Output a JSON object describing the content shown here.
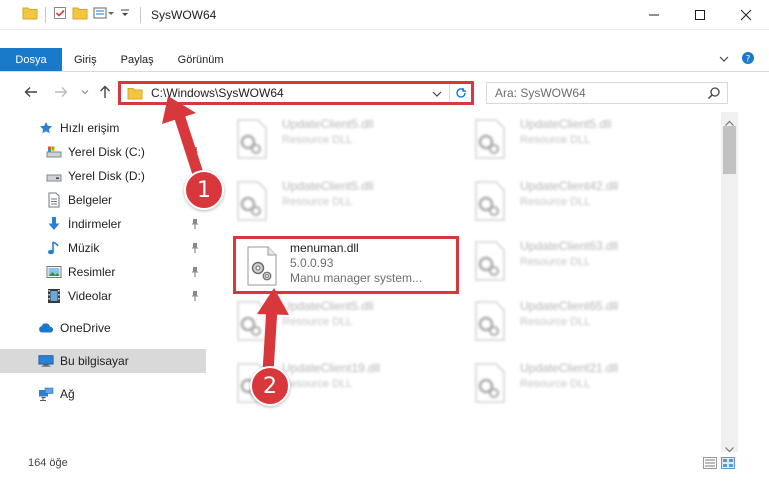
{
  "window": {
    "title": "SysWOW64"
  },
  "ribbon": {
    "tabs": [
      "Dosya",
      "Giriş",
      "Paylaş",
      "Görünüm"
    ]
  },
  "address": {
    "path": "C:\\Windows\\SysWOW64",
    "search_placeholder": "Ara: SysWOW64"
  },
  "sidebar": {
    "items": [
      {
        "label": "Hızlı erişim",
        "icon": "star-icon"
      },
      {
        "label": "Yerel Disk (C:)",
        "icon": "drive-icon"
      },
      {
        "label": "Yerel Disk (D:)",
        "icon": "drive-icon"
      },
      {
        "label": "Belgeler",
        "icon": "document-icon"
      },
      {
        "label": "İndirmeler",
        "icon": "download-icon"
      },
      {
        "label": "Müzik",
        "icon": "music-icon"
      },
      {
        "label": "Resimler",
        "icon": "pictures-icon"
      },
      {
        "label": "Videolar",
        "icon": "video-icon"
      },
      {
        "label": "OneDrive",
        "icon": "cloud-icon"
      },
      {
        "label": "Bu bilgisayar",
        "icon": "computer-icon"
      },
      {
        "label": "Ağ",
        "icon": "network-icon"
      }
    ]
  },
  "files": [
    {
      "name": "UpdateClient5.dll",
      "type": "Resource DLL"
    },
    {
      "name": "UpdateClient5.dll",
      "type": "Resource DLL"
    },
    {
      "name": "UpdateClient5.dll",
      "type": "Resource DLL"
    },
    {
      "name": "UpdateClient42.dll",
      "type": "Resource DLL"
    },
    {
      "name": "UpdateClient63.dll",
      "type": "Resource DLL"
    },
    {
      "name": "UpdateClient5.dll",
      "type": "Resource DLL"
    },
    {
      "name": "UpdateClient65.dll",
      "type": "Resource DLL"
    },
    {
      "name": "UpdateClient19.dll",
      "type": "Resource DLL"
    },
    {
      "name": "UpdateClient21.dll",
      "type": "Resource DLL"
    }
  ],
  "selected_file": {
    "name": "menuman.dll",
    "version": "5.0.0.93",
    "description": "Manu manager system..."
  },
  "status": {
    "count": "164 öğe"
  },
  "annotations": {
    "step1": "1",
    "step2": "2"
  },
  "colors": {
    "accent": "#1979ca",
    "annotation": "#d8383c",
    "folder": "#f3c640"
  }
}
